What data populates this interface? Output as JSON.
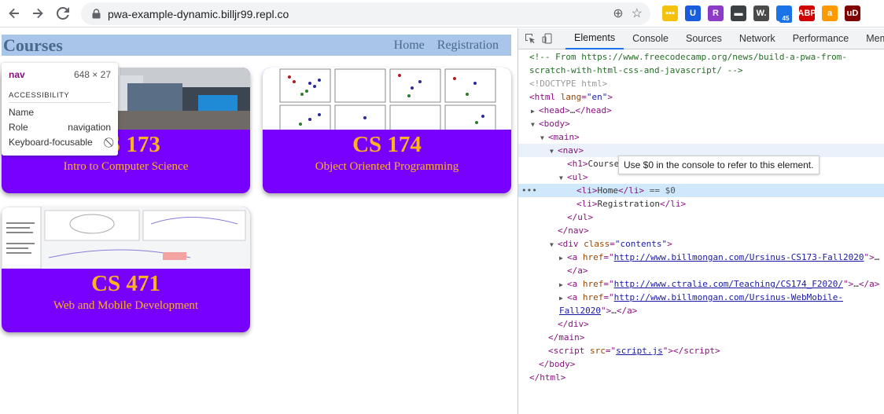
{
  "browser": {
    "url": "pwa-example-dynamic.billjr99.repl.co",
    "extension_badge": "45",
    "extensions": [
      {
        "name": "grid-ext-icon",
        "color": "#f4c20d",
        "label": "▪▪▪"
      },
      {
        "name": "bitwarden-icon",
        "color": "#175ddc",
        "label": "U"
      },
      {
        "name": "r-ext-icon",
        "color": "#8d3ac6",
        "label": "R"
      },
      {
        "name": "folder-ext-icon",
        "color": "#3c4043",
        "label": "▬"
      },
      {
        "name": "w-ext-icon",
        "color": "#4a4a4a",
        "label": "W."
      },
      {
        "name": "cloud-ext-icon",
        "color": "#1a73e8",
        "label": "☁"
      },
      {
        "name": "abp-icon",
        "color": "#d00000",
        "label": "ABP"
      },
      {
        "name": "amazon-icon",
        "color": "#f90",
        "label": "a"
      },
      {
        "name": "ublock-icon",
        "color": "#800000",
        "label": "uD"
      }
    ]
  },
  "site": {
    "title": "Courses",
    "nav_links": [
      "Home",
      "Registration"
    ],
    "cards": [
      {
        "title": "CS 173",
        "subtitle": "Intro to Computer Science"
      },
      {
        "title": "CS 174",
        "subtitle": "Object Oriented Programming"
      },
      {
        "title": "CS 471",
        "subtitle": "Web and Mobile Development"
      }
    ]
  },
  "inspect_tooltip": {
    "tag": "nav",
    "dimensions": "648 × 27",
    "section": "ACCESSIBILITY",
    "rows": [
      {
        "key": "Name",
        "value": ""
      },
      {
        "key": "Role",
        "value": "navigation"
      },
      {
        "key": "Keyboard-focusable",
        "value": "⃠"
      }
    ]
  },
  "devtools": {
    "tabs": [
      "Elements",
      "Console",
      "Sources",
      "Network",
      "Performance",
      "Mem"
    ],
    "active_tab": "Elements",
    "hint": "Use $0 in the console to refer to this element.",
    "tree": {
      "comment1": "<!-- From https://www.freecodecamp.org/news/build-a-pwa-from-",
      "comment2": "scratch-with-html-css-and-javascript/ -->",
      "doctype": "<!DOCTYPE html>",
      "html_open_tag": "html",
      "html_lang_attr": "lang",
      "html_lang_val": "\"en\"",
      "head": "head",
      "head_ellipsis": "…",
      "body": "body",
      "main": "main",
      "nav": "nav",
      "h1_text": "Course",
      "ul": "ul",
      "li1": "Home",
      "li1_suffix": " == $0",
      "li2": "Registration",
      "div_class_attr": "class",
      "div_class_val": "\"contents\"",
      "link1": "http://www.billmongan.com/Ursinus-CS173-Fall2020",
      "link2": "http://www.ctralie.com/Teaching/CS174_F2020/",
      "link3a": "http://www.billmongan.com/Ursinus-WebMobile-",
      "link3b": "Fall2020",
      "script_src": "script.js",
      "ellipsis": "…"
    }
  }
}
